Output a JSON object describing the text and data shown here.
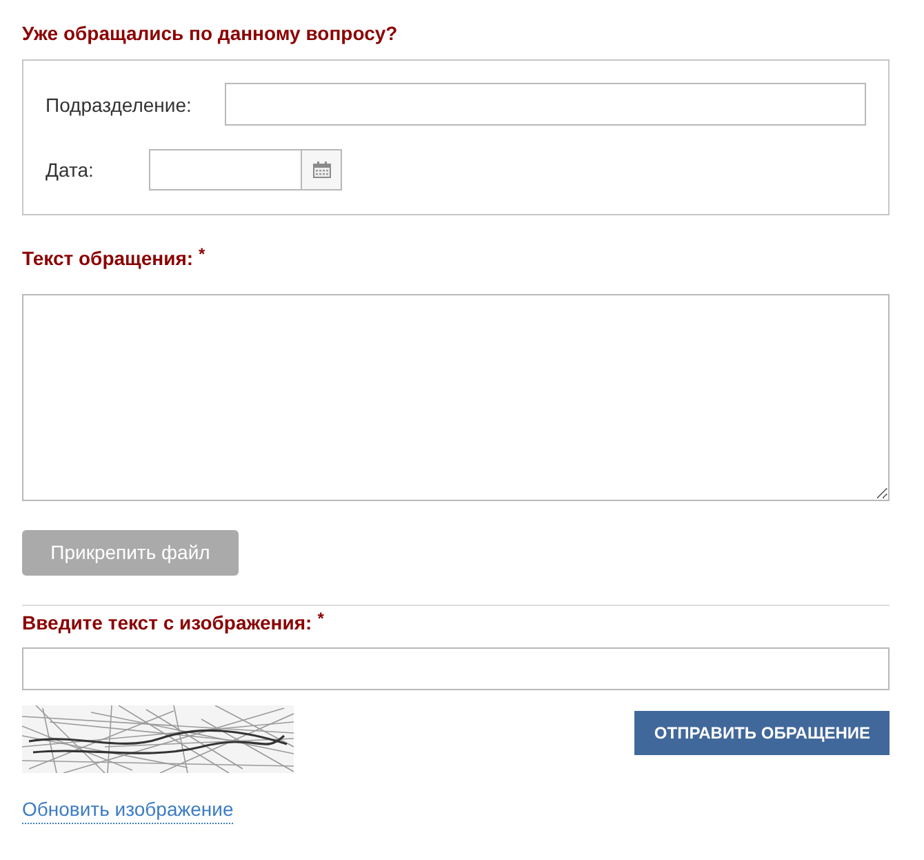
{
  "previous_request": {
    "title": "Уже обращались по данному вопросу?",
    "fields": [
      {
        "kind": "text",
        "label": "Подразделение:"
      },
      {
        "kind": "date",
        "label": "Дата:"
      }
    ]
  },
  "message": {
    "label": "Текст обращения:",
    "required_mark": "*"
  },
  "attach_button": {
    "label": "Прикрепить файл"
  },
  "captcha": {
    "label": "Введите текст с изображения:",
    "required_mark": "*",
    "refresh_link": "Обновить изображение"
  },
  "submit_button": {
    "label": "ОТПРАВИТЬ ОБРАЩЕНИЕ"
  }
}
